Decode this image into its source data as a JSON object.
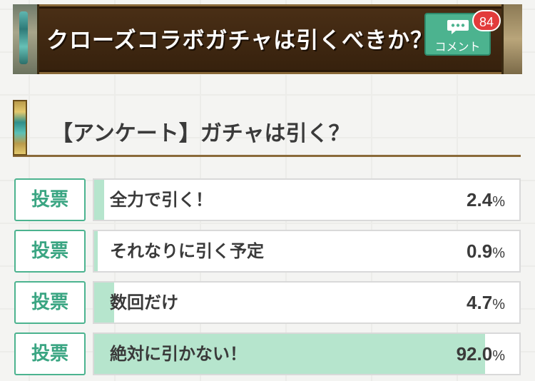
{
  "banner": {
    "title": "クローズコラボガチャは引くべきか？",
    "comment_label": "コメント",
    "comment_count": "84"
  },
  "poll": {
    "heading": "【アンケート】ガチャは引く？",
    "vote_label": "投票",
    "percent_sign": "%",
    "options": [
      {
        "label": "全力で引く！",
        "percent": "2.4",
        "share": 0.024
      },
      {
        "label": "それなりに引く予定",
        "percent": "0.9",
        "share": 0.009
      },
      {
        "label": "数回だけ",
        "percent": "4.7",
        "share": 0.047
      },
      {
        "label": "絶対に引かない！",
        "percent": "92.0",
        "share": 0.92
      }
    ]
  },
  "colors": {
    "accent": "#4cb38f",
    "bar_fill": "#b6e5cd",
    "banner_bg": "#3b2410",
    "badge": "#e23b3b"
  },
  "icons": {
    "comment": "speech-bubble-icon"
  }
}
